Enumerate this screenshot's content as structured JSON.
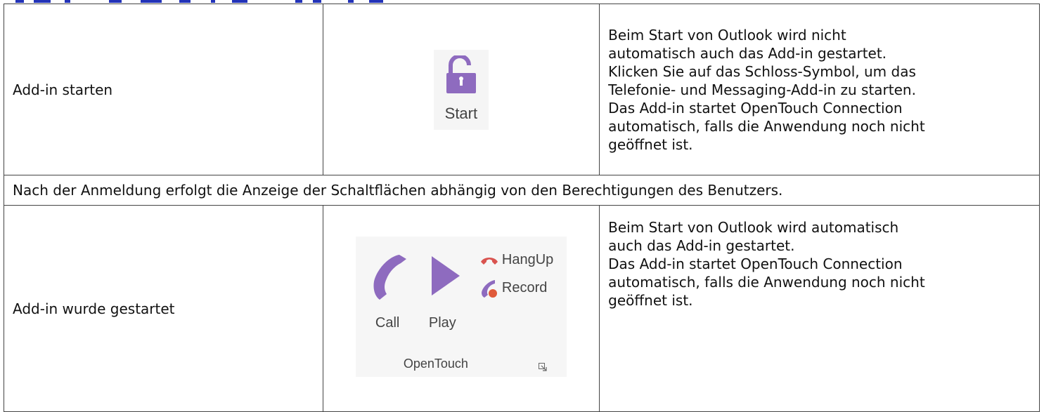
{
  "rows": [
    {
      "title": "Add-in starten",
      "icon_label": "Start",
      "description": [
        "Beim Start von Outlook wird nicht",
        "automatisch auch das Add-in gestartet.",
        "Klicken Sie auf das Schloss-Symbol, um das",
        "Telefonie- und Messaging-Add-in zu starten.",
        "Das Add-in startet OpenTouch Connection",
        "automatisch, falls die Anwendung noch nicht",
        "geöffnet ist."
      ]
    },
    {
      "note": "Nach der Anmeldung erfolgt die Anzeige der Schaltflächen abhängig von den Berechtigungen des Benutzers."
    },
    {
      "title": "Add-in wurde gestartet",
      "ribbon": {
        "call_label": "Call",
        "play_label": "Play",
        "hangup_label": "HangUp",
        "record_label": "Record",
        "group_label": "OpenTouch"
      },
      "description": [
        "Beim Start von Outlook wird automatisch",
        "auch das Add-in gestartet.",
        "Das Add-in startet OpenTouch Connection",
        "automatisch, falls die Anwendung noch nicht",
        "geöffnet ist."
      ]
    }
  ],
  "colors": {
    "icon_purple": "#8e6bbf",
    "hangup_red": "#d9534f",
    "heading_blue": "#2333b8"
  }
}
